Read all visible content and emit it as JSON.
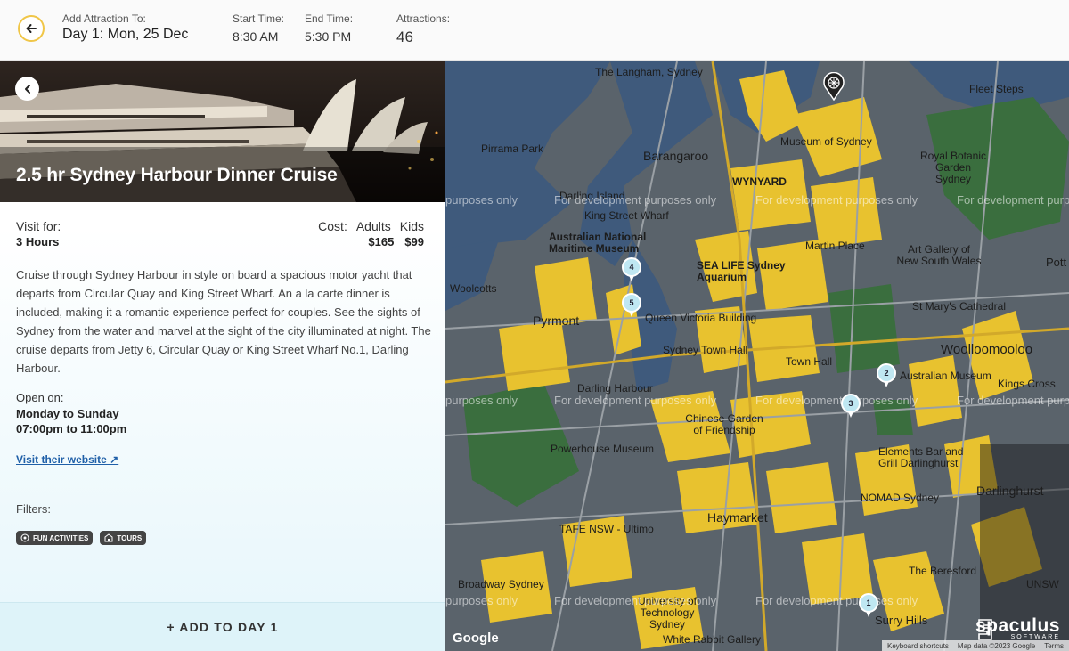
{
  "header": {
    "add_to_label": "Add Attraction To:",
    "day_title": "Day 1: Mon, 25 Dec",
    "start_label": "Start Time:",
    "start_value": "8:30 AM",
    "end_label": "End Time:",
    "end_value": "5:30 PM",
    "attractions_label": "Attractions:",
    "attractions_count": "46"
  },
  "attraction": {
    "title": "2.5 hr Sydney Harbour Dinner Cruise",
    "visit_label": "Visit for:",
    "visit_value": "3 Hours",
    "cost_label": "Cost:",
    "adults_label": "Adults",
    "kids_label": "Kids",
    "adults_price": "$165",
    "kids_price": "$99",
    "description": "Cruise through Sydney Harbour in style on board a spacious motor yacht that departs from Circular Quay and King Street Wharf. An a la carte dinner is included, making it a romantic experience perfect for couples. See the sights of Sydney from the water and marvel at the sight of the city illuminated at night. The cruise departs from Jetty 6, Circular Quay or King Street Wharf No.1, Darling Harbour.",
    "open_label": "Open on:",
    "open_days": "Monday to Sunday",
    "open_hours": "07:00pm to 11:00pm",
    "website_label": "Visit their website ↗",
    "filters_label": "Filters:",
    "filters": [
      "FUN ACTIVITIES",
      "TOURS"
    ],
    "add_button": "+ ADD TO DAY 1"
  },
  "map": {
    "labels": {
      "langham": "The Langham, Sydney",
      "fleet_steps": "Fleet Steps",
      "museum_of_sydney": "Museum of Sydney",
      "pirrama_park": "Pirrama Park",
      "barangaroo": "Barangaroo",
      "wynyard": "WYNYARD",
      "royal_botanic": "Royal Botanic Garden Sydney",
      "darling_island": "Darling Island",
      "king_street_wharf": "King Street Wharf",
      "maritime_museum": "Australian National Maritime Museum",
      "martin_place": "Martin Place",
      "art_gallery": "Art Gallery of New South Wales",
      "potts": "Pott",
      "sea_life": "SEA LIFE Sydney Aquarium",
      "woolcotts": "Woolcotts",
      "pyrmont": "Pyrmont",
      "qvb": "Queen Victoria Building",
      "st_marys": "St Mary's Cathedral",
      "town_hall_b": "Sydney Town Hall",
      "town_hall": "Town Hall",
      "woolloomooloo": "Woolloomooloo",
      "australian_museum": "Australian Museum",
      "kings_cross": "Kings Cross",
      "darling_harbour": "Darling Harbour",
      "chinese_garden": "Chinese Garden of Friendship",
      "powerhouse": "Powerhouse Museum",
      "elements_bar": "Elements Bar and Grill Darlinghurst",
      "darlinghurst": "Darlinghurst",
      "nomad": "NOMAD Sydney",
      "haymarket": "Haymarket",
      "tafe": "TAFE NSW - Ultimo",
      "beresford": "The Beresford",
      "broadway": "Broadway Sydney",
      "uts": "University of Technology Sydney",
      "surry_hills": "Surry Hills",
      "white_rabbit": "White Rabbit Gallery",
      "unsw": "UNSW"
    },
    "watermark": "For development purposes only",
    "watermark_short": "purposes only",
    "watermark_cut": "For development purp",
    "pins": [
      "1",
      "2",
      "3",
      "4",
      "5"
    ],
    "google": "Google",
    "keyboard": "Keyboard shortcuts",
    "map_data": "Map data ©2023 Google",
    "terms": "Terms"
  },
  "brand": {
    "name": "spaculus",
    "tagline": "SOFTWARE"
  },
  "colors": {
    "accent_yellow": "#f0c648",
    "map_block_yellow": "#e8c22f",
    "map_water": "#3f5a7c",
    "map_park": "#3a6e3e",
    "pin_fill": "#bfe7f2",
    "add_button_bg": "#def3f9",
    "link_blue": "#1f5fa8"
  },
  "icons": [
    "back-arrow-icon",
    "chevron-left-icon",
    "external-link-icon",
    "fun-activities-icon",
    "tours-icon",
    "ferris-wheel-marker-icon",
    "map-pin-icon"
  ]
}
